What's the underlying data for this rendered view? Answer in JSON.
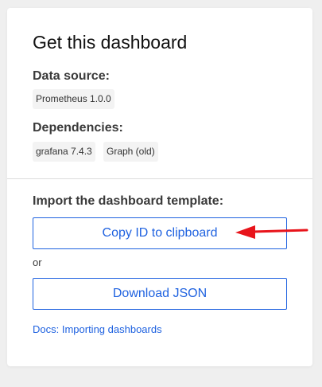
{
  "card": {
    "title": "Get this dashboard",
    "data_source": {
      "label": "Data source:",
      "chips": [
        "Prometheus 1.0.0"
      ]
    },
    "dependencies": {
      "label": "Dependencies:",
      "chips": [
        "grafana 7.4.3",
        "Graph (old)"
      ]
    },
    "import": {
      "label": "Import the dashboard template:",
      "copy_button": "Copy ID to clipboard",
      "or_text": "or",
      "download_button": "Download JSON",
      "docs_link": "Docs: Importing dashboards"
    }
  },
  "annotation": {
    "icon": "red-arrow-icon",
    "color": "#e8141b"
  },
  "colors": {
    "accent": "#1f62e0",
    "background": "#efefef",
    "chip_bg": "#f3f3f3"
  }
}
